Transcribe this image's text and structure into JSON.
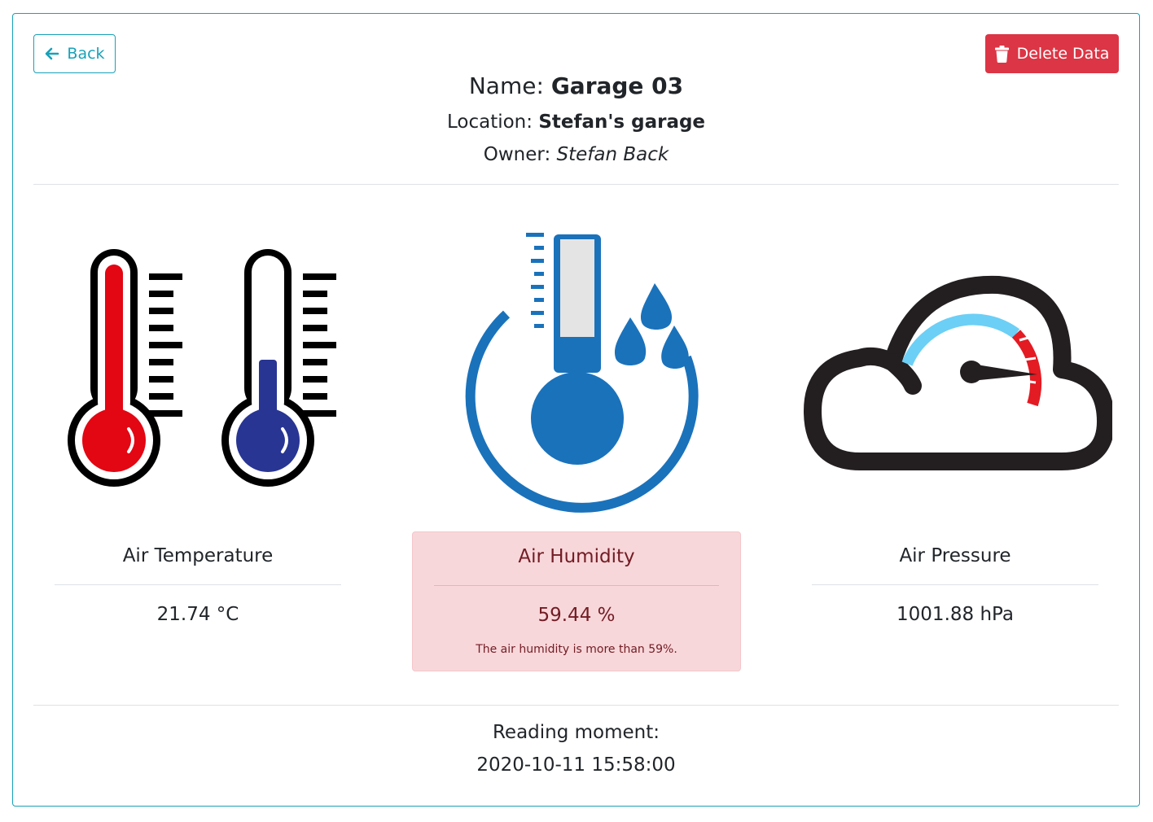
{
  "toolbar": {
    "back_label": "Back",
    "delete_label": "Delete Data"
  },
  "device": {
    "name_label": "Name: ",
    "name": "Garage 03",
    "location_label": "Location: ",
    "location": "Stefan's garage",
    "owner_label": "Owner: ",
    "owner": "Stefan Back"
  },
  "metrics": [
    {
      "label": "Air Temperature",
      "value": "21.74 °C",
      "icon": "thermometers-icon"
    },
    {
      "label": "Air Humidity",
      "value": "59.44 %",
      "note": "The air humidity is more than 59%.",
      "icon": "humidity-icon",
      "status": "alert"
    },
    {
      "label": "Air Pressure",
      "value": "1001.88 hPa",
      "icon": "pressure-gauge-cloud-icon"
    }
  ],
  "reading": {
    "label": "Reading moment:",
    "value": "2020-10-11 15:58:00"
  },
  "colors": {
    "accent": "#17a2b8",
    "danger": "#dc3545",
    "alert_bg": "#f8d7da",
    "alert_text": "#721c24"
  }
}
